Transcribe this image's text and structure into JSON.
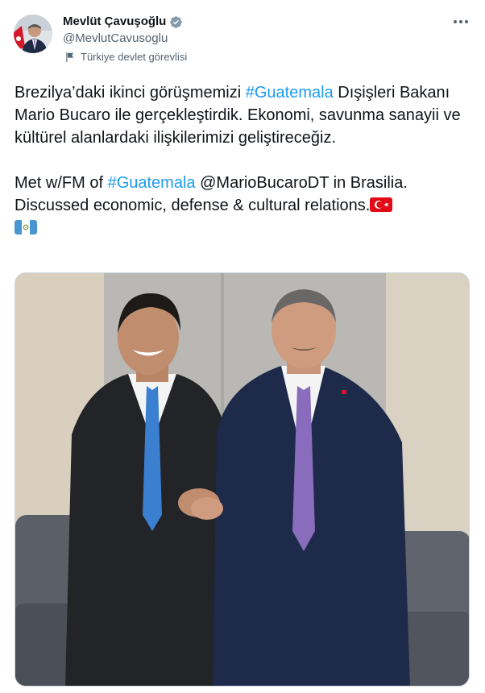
{
  "author": {
    "name": "Mevlüt Çavuşoğlu",
    "handle": "@MevlutCavusoglu",
    "label": "Türkiye devlet görevlisi"
  },
  "tweet": {
    "p1_pre": "Brezilya’daki ikinci görüşmemizi ",
    "p1_tag": "#Guatemala",
    "p1_post": " Dışişleri Bakanı Mario Bucaro ile gerçekleştirdik. Ekonomi, savunma sanayii ve kültürel alanlardaki ilişkilerimizi geliştireceğiz.",
    "p2_pre": "Met w/FM of ",
    "p2_tag": "#Guatemala",
    "p2_mid": " @MarioBucaroDT in Brasilia. Discussed economic, defense & cultural relations."
  },
  "icons": {
    "verified": "verified-badge-icon",
    "label_flag": "flag-icon",
    "more": "more-icon",
    "emoji_tr": "turkey-flag-emoji",
    "emoji_gt": "guatemala-flag-emoji"
  },
  "colors": {
    "link": "#1d9bf0",
    "secondary_text": "#536471",
    "verified": "#829aab"
  }
}
